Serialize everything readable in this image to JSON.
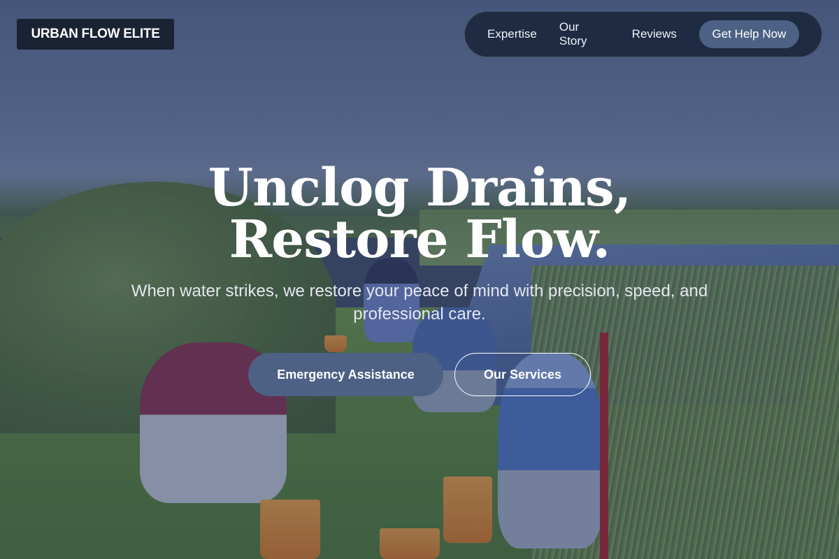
{
  "header": {
    "logo_text": "URBAN FLOW ELITE",
    "nav": [
      {
        "label": "Expertise"
      },
      {
        "label": "Our Story"
      },
      {
        "label": "Reviews"
      }
    ],
    "cta_label": "Get Help Now"
  },
  "hero": {
    "headline": "Unclog Drains, Restore Flow.",
    "subheadline": "When water strikes, we restore your peace of mind with precision, speed, and professional care.",
    "primary_button": "Emergency Assistance",
    "secondary_button": "Our Services"
  },
  "colors": {
    "accent": "#4c6184",
    "nav_bg": "#182337",
    "logo_bg": "#1a2333",
    "text": "#ffffff"
  }
}
